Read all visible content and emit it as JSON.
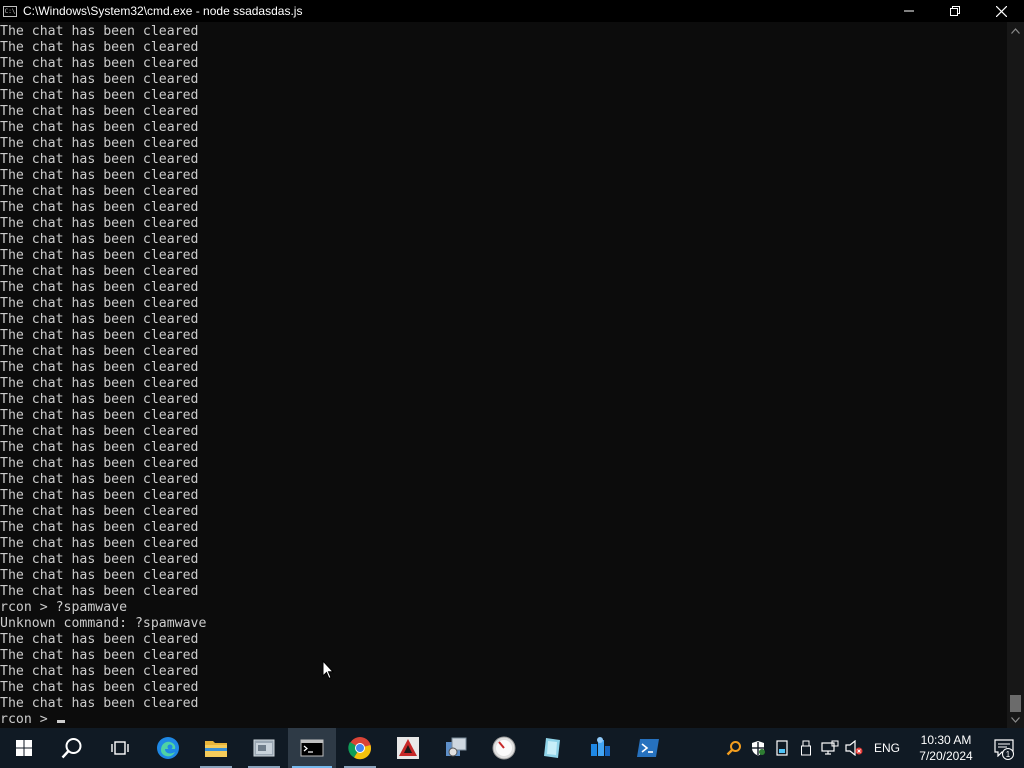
{
  "window": {
    "title": "C:\\Windows\\System32\\cmd.exe - node  ssadasdas.js",
    "app_icon_text": "C:\\"
  },
  "console": {
    "lines": [
      "The chat has been cleared",
      "The chat has been cleared",
      "The chat has been cleared",
      "The chat has been cleared",
      "The chat has been cleared",
      "The chat has been cleared",
      "The chat has been cleared",
      "The chat has been cleared",
      "The chat has been cleared",
      "The chat has been cleared",
      "The chat has been cleared",
      "The chat has been cleared",
      "The chat has been cleared",
      "The chat has been cleared",
      "The chat has been cleared",
      "The chat has been cleared",
      "The chat has been cleared",
      "The chat has been cleared",
      "The chat has been cleared",
      "The chat has been cleared",
      "The chat has been cleared",
      "The chat has been cleared",
      "The chat has been cleared",
      "The chat has been cleared",
      "The chat has been cleared",
      "The chat has been cleared",
      "The chat has been cleared",
      "The chat has been cleared",
      "The chat has been cleared",
      "The chat has been cleared",
      "The chat has been cleared",
      "The chat has been cleared",
      "The chat has been cleared",
      "The chat has been cleared",
      "The chat has been cleared",
      "The chat has been cleared",
      "rcon > ?spamwave",
      "Unknown command: ?spamwave",
      "The chat has been cleared",
      "The chat has been cleared",
      "The chat has been cleared",
      "The chat has been cleared",
      "The chat has been cleared"
    ],
    "prompt": "rcon > "
  },
  "taskbar": {
    "items": [
      {
        "name": "start-button",
        "icon": "windows-logo-icon",
        "state": "normal"
      },
      {
        "name": "search-button",
        "icon": "search-icon",
        "state": "normal"
      },
      {
        "name": "task-view-button",
        "icon": "task-view-icon",
        "state": "normal"
      },
      {
        "name": "taskbar-edge",
        "icon": "edge-icon",
        "state": "normal"
      },
      {
        "name": "taskbar-file-explorer",
        "icon": "folder-icon",
        "state": "running"
      },
      {
        "name": "taskbar-app-1",
        "icon": "app-window-icon",
        "state": "running"
      },
      {
        "name": "taskbar-cmd",
        "icon": "terminal-icon",
        "state": "active"
      },
      {
        "name": "taskbar-chrome",
        "icon": "chrome-icon",
        "state": "running"
      },
      {
        "name": "taskbar-app-2",
        "icon": "app-red-icon",
        "state": "normal"
      },
      {
        "name": "taskbar-app-3",
        "icon": "app-tools-icon",
        "state": "normal"
      },
      {
        "name": "taskbar-app-4",
        "icon": "app-gauge-icon",
        "state": "normal"
      },
      {
        "name": "taskbar-app-5",
        "icon": "app-note-icon",
        "state": "normal"
      },
      {
        "name": "taskbar-app-6",
        "icon": "app-blue-icon",
        "state": "normal"
      },
      {
        "name": "taskbar-powershell",
        "icon": "powershell-icon",
        "state": "normal"
      }
    ],
    "tray": {
      "language": "ENG",
      "time": "10:30 AM",
      "date": "7/20/2024",
      "notification_count": "1",
      "icons": [
        "search-tray-icon",
        "security-icon",
        "storage-icon",
        "usb-icon",
        "network-icon",
        "volume-muted-icon"
      ]
    }
  },
  "colors": {
    "console_bg": "#0c0c0c",
    "console_fg": "#cccccc",
    "titlebar_bg": "#000000",
    "taskbar_bg": "#101a24",
    "accent": "#76b9ed"
  }
}
